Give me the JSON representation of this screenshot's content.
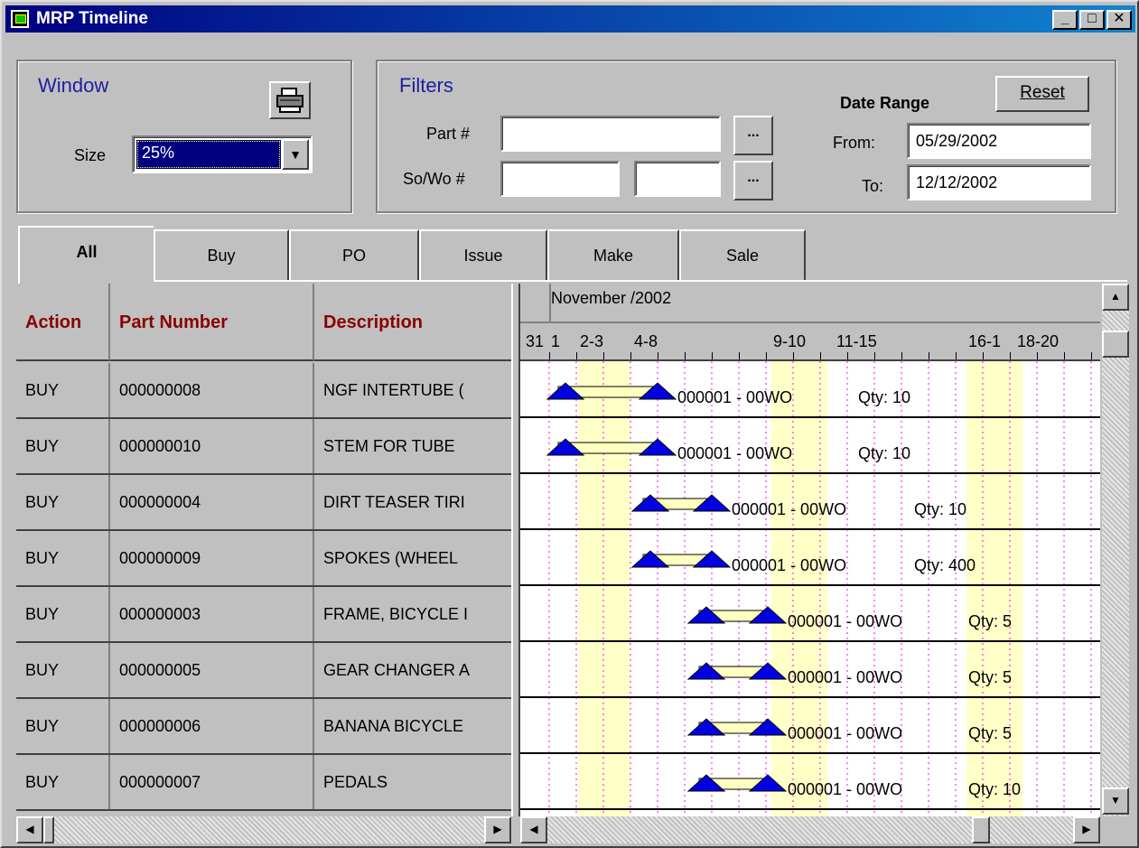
{
  "window": {
    "title": "MRP Timeline"
  },
  "title_buttons": {
    "minimize": "_",
    "maximize": "□",
    "close": "✕"
  },
  "window_group": {
    "label": "Window",
    "size_label": "Size",
    "size_value": "25%",
    "print_icon": "printer-icon"
  },
  "filters": {
    "label": "Filters",
    "part_label": "Part #",
    "part_value": "",
    "sowo_label": "So/Wo #",
    "sowo_value1": "",
    "sowo_value2": "",
    "browse_label": "...",
    "date_range_label": "Date Range",
    "reset_label": "Reset",
    "from_label": "From:",
    "from_value": "05/29/2002",
    "to_label": "To:",
    "to_value": "12/12/2002"
  },
  "tabs": [
    "All",
    "Buy",
    "PO",
    "Issue",
    "Make",
    "Sale"
  ],
  "grid": {
    "headers": [
      "Action",
      "Part Number",
      "Description"
    ],
    "rows": [
      {
        "action": "BUY",
        "part": "000000008",
        "desc": "NGF INTERTUBE (",
        "order": "000001 - 00WO",
        "qty": "Qty: 10"
      },
      {
        "action": "BUY",
        "part": "000000010",
        "desc": "STEM FOR TUBE",
        "order": "000001 - 00WO",
        "qty": "Qty: 10"
      },
      {
        "action": "BUY",
        "part": "000000004",
        "desc": "DIRT TEASER TIRI",
        "order": "000001 - 00WO",
        "qty": "Qty: 10"
      },
      {
        "action": "BUY",
        "part": "000000009",
        "desc": "SPOKES (WHEEL",
        "order": "000001 - 00WO",
        "qty": "Qty: 400"
      },
      {
        "action": "BUY",
        "part": "000000003",
        "desc": "FRAME, BICYCLE I",
        "order": "000001 - 00WO",
        "qty": "Qty: 5"
      },
      {
        "action": "BUY",
        "part": "000000005",
        "desc": "GEAR CHANGER A",
        "order": "000001 - 00WO",
        "qty": "Qty: 5"
      },
      {
        "action": "BUY",
        "part": "000000006",
        "desc": "BANANA BICYCLE",
        "order": "000001 - 00WO",
        "qty": "Qty: 5"
      },
      {
        "action": "BUY",
        "part": "000000007",
        "desc": "PEDALS",
        "order": "000001 - 00WO",
        "qty": "Qty: 10"
      }
    ]
  },
  "timeline": {
    "month": "November /2002",
    "ticks": [
      "31",
      "1",
      "2-3",
      "4-8",
      "9-10",
      "11-15",
      "16-1",
      "18-20"
    ]
  },
  "colors": {
    "weekend": "#ffffc8",
    "marker": "#0000e0",
    "header_text": "#8b0000",
    "group_label": "#1e1ea0"
  }
}
